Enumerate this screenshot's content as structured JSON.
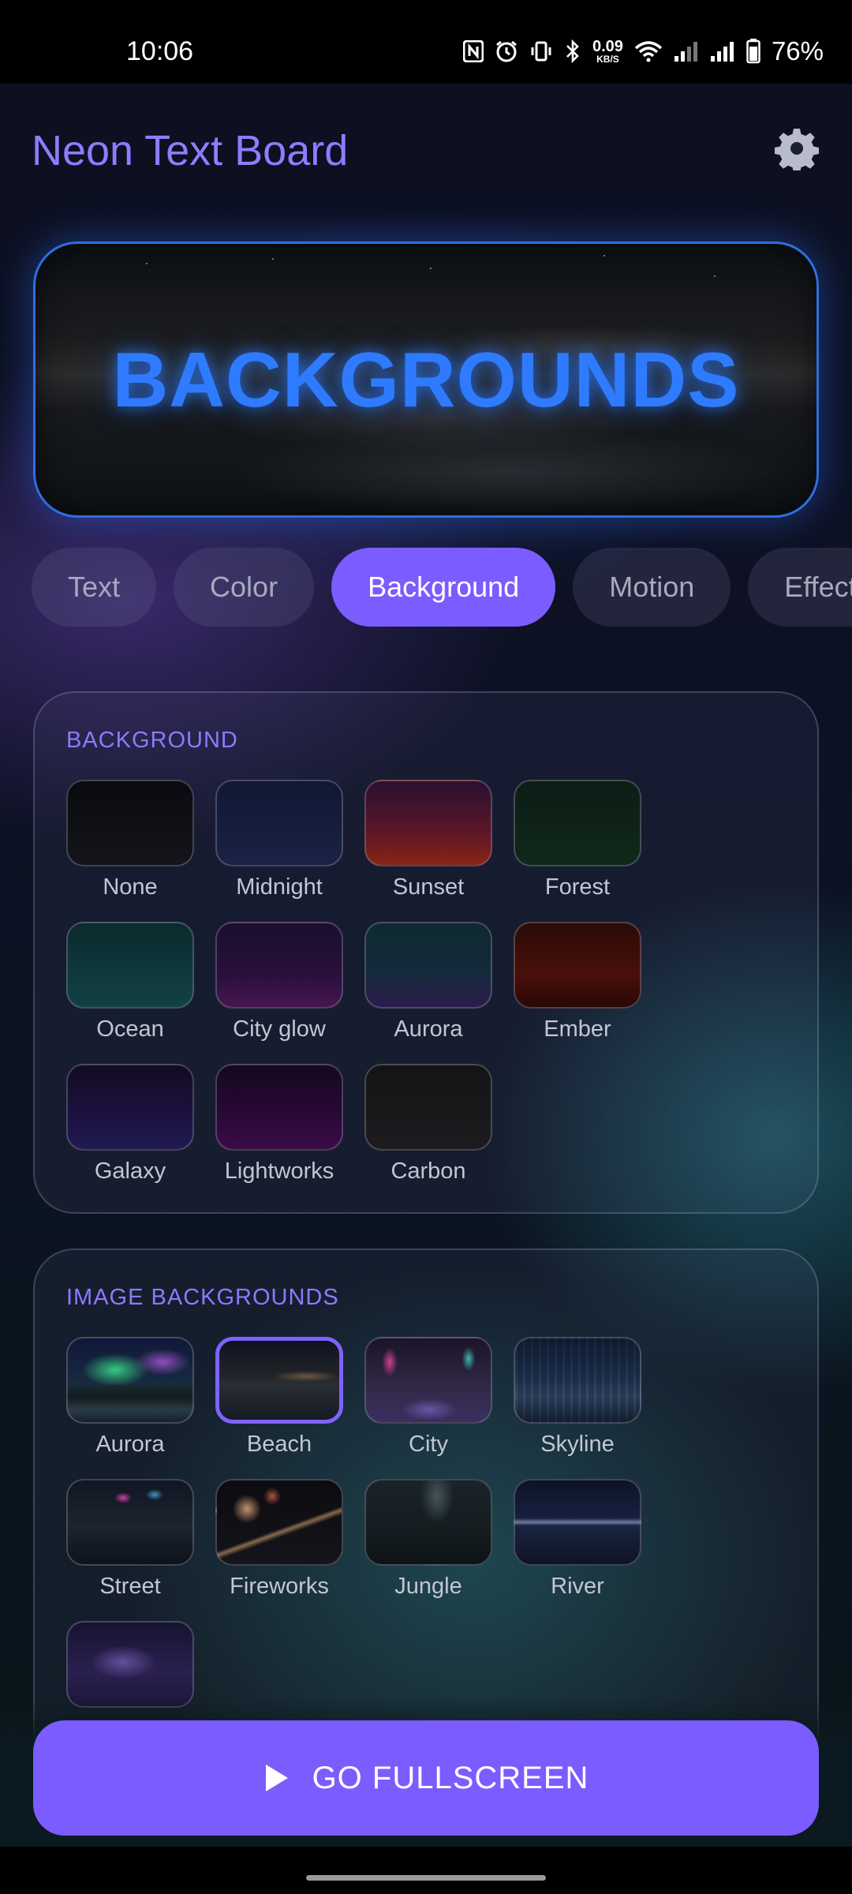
{
  "status_bar": {
    "time": "10:06",
    "net_speed_value": "0.09",
    "net_speed_unit": "KB/S",
    "battery": "76%",
    "icons": [
      "nfc-icon",
      "alarm-icon",
      "vibrate-icon",
      "bluetooth-icon",
      "wifi-icon",
      "signal-icon",
      "signal-icon",
      "battery-icon"
    ]
  },
  "header": {
    "title": "Neon Text Board",
    "settings_icon": "gear-icon"
  },
  "preview": {
    "text": "BACKGROUNDS",
    "text_color": "#2f7bff",
    "border_color": "#2f6de0"
  },
  "tabs": [
    {
      "label": "Text",
      "active": false
    },
    {
      "label": "Color",
      "active": false
    },
    {
      "label": "Background",
      "active": true
    },
    {
      "label": "Motion",
      "active": false
    },
    {
      "label": "Effects",
      "active": false
    }
  ],
  "background_panel": {
    "title": "BACKGROUND",
    "items": [
      {
        "label": "None"
      },
      {
        "label": "Midnight"
      },
      {
        "label": "Sunset"
      },
      {
        "label": "Forest"
      },
      {
        "label": "Ocean"
      },
      {
        "label": "City glow"
      },
      {
        "label": "Aurora"
      },
      {
        "label": "Ember"
      },
      {
        "label": "Galaxy"
      },
      {
        "label": "Lightworks"
      },
      {
        "label": "Carbon"
      }
    ]
  },
  "image_panel": {
    "title": "IMAGE BACKGROUNDS",
    "selected": "Beach",
    "items": [
      {
        "label": "Aurora"
      },
      {
        "label": "Beach"
      },
      {
        "label": "City"
      },
      {
        "label": "Skyline"
      },
      {
        "label": "Street"
      },
      {
        "label": "Fireworks"
      },
      {
        "label": "Jungle"
      },
      {
        "label": "River"
      }
    ]
  },
  "fullscreen_button": {
    "label": "GO FULLSCREEN",
    "icon": "play-icon"
  },
  "colors": {
    "accent": "#7b5cff",
    "title": "#8f7cff"
  }
}
